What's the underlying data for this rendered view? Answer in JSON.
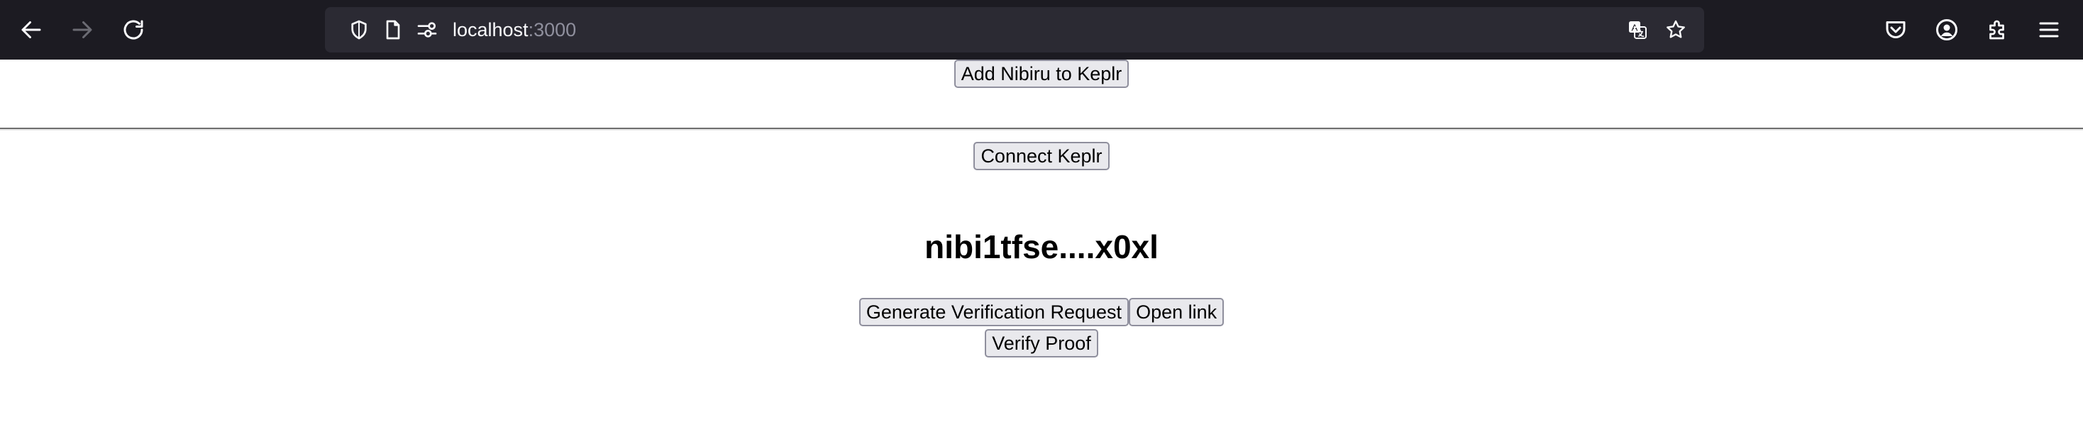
{
  "browser": {
    "url_host": "localhost",
    "url_port": ":3000",
    "icons": {
      "back": "back-arrow-icon",
      "forward": "forward-arrow-icon",
      "reload": "reload-icon",
      "tracking": "shield-icon",
      "page": "page-icon",
      "permissions": "permissions-icon",
      "translate": "translate-icon",
      "bookmark": "star-icon",
      "pocket": "pocket-icon",
      "account": "account-icon",
      "extensions": "extensions-icon",
      "menu": "hamburger-menu-icon"
    },
    "colors": {
      "toolbar_bg": "#1c1b22",
      "urlbar_bg": "#2b2a33",
      "url_text": "#fbfbfe",
      "url_port": "#8f8f9d"
    }
  },
  "page": {
    "add_network_label": "Add Nibiru to Keplr",
    "connect_label": "Connect Keplr",
    "address": "nibi1tfse....x0xl",
    "generate_label": "Generate Verification Request",
    "open_link_label": "Open link",
    "verify_label": "Verify Proof"
  }
}
